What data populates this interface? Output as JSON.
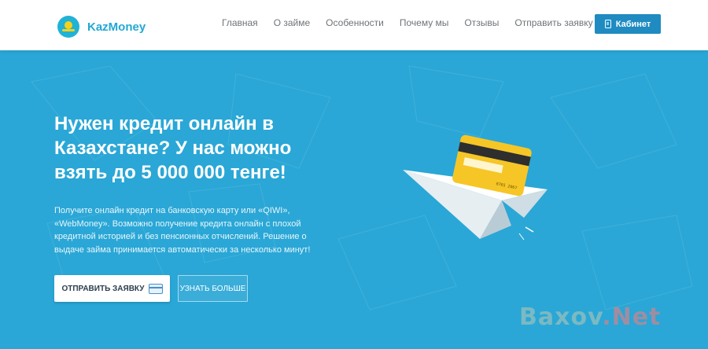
{
  "header": {
    "brand": "KazMoney",
    "nav": [
      "Главная",
      "О займе",
      "Особенности",
      "Почему мы",
      "Отзывы",
      "Отправить заявку"
    ],
    "cabinet_label": "Кабинет"
  },
  "hero": {
    "headline": "Нужен кредит онлайн в Казахстане? У нас можно взять до 5 000 000 тенге!",
    "description": "Получите онлайн кредит на банковскую карту или «QIWI», «WebMoney». Возможно получение кредита онлайн с плохой кредитной историей и без пенсионных отчислений. Решение о выдаче займа принимается автоматически за несколько минут!",
    "apply_button": "ОТПРАВИТЬ ЗАЯВКУ",
    "more_button": "УЗНАТЬ БОЛЬШЕ",
    "card_number": "8765 2067"
  },
  "watermark": {
    "text_a": "Baxov",
    "text_b": ".Net"
  },
  "colors": {
    "hero_bg": "#2aa7d6",
    "brand": "#22a8d3",
    "cabinet_button": "#1f8bc1",
    "card_yellow": "#f6c627"
  },
  "icons": [
    "kazakhstan-flag-icon",
    "phone-icon",
    "credit-card-icon"
  ]
}
